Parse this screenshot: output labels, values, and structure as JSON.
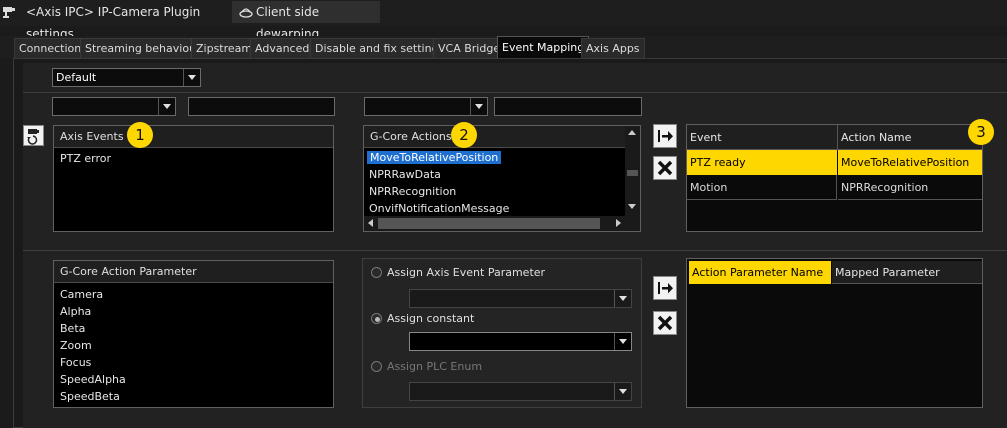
{
  "title_tabs": [
    {
      "label": "<Axis IPC> IP-Camera Plugin settings"
    },
    {
      "label": "Client side dewarping"
    }
  ],
  "tabs": [
    "Connection",
    "Streaming behaviour",
    "Zipstream",
    "Advanced",
    "Disable and fix settings",
    "VCA Bridge",
    "Event Mapping",
    "Axis Apps"
  ],
  "active_tab": "Event Mapping",
  "profile_select": {
    "value": "Default"
  },
  "axis_events": {
    "header": "Axis Events",
    "badge": "1",
    "items": [
      "PTZ error"
    ]
  },
  "gcore_actions": {
    "header": "G-Core Actions",
    "badge": "2",
    "items": [
      "MoveToRelativePosition",
      "NPRRawData",
      "NPRRecognition",
      "OnvifNotificationMessage"
    ],
    "selected": "MoveToRelativePosition"
  },
  "mapping_table": {
    "badge": "3",
    "columns": [
      "Event",
      "Action Name"
    ],
    "rows": [
      {
        "event": "PTZ ready",
        "action": "MoveToRelativePosition",
        "highlighted": true
      },
      {
        "event": "Motion",
        "action": "NPRRecognition",
        "highlighted": false
      }
    ]
  },
  "action_params": {
    "header": "G-Core Action Parameter",
    "items": [
      "Camera",
      "Alpha",
      "Beta",
      "Zoom",
      "Focus",
      "SpeedAlpha",
      "SpeedBeta"
    ]
  },
  "assign": {
    "axis_event_param": "Assign Axis Event Parameter",
    "constant": "Assign constant",
    "plc_enum": "Assign PLC Enum",
    "selected": "constant"
  },
  "param_table": {
    "columns": [
      "Action Parameter Name",
      "Mapped Parameter"
    ]
  },
  "colors": {
    "highlight": "#ffd700",
    "selection": "#1e6fd0",
    "background": "#1b1b1b"
  }
}
